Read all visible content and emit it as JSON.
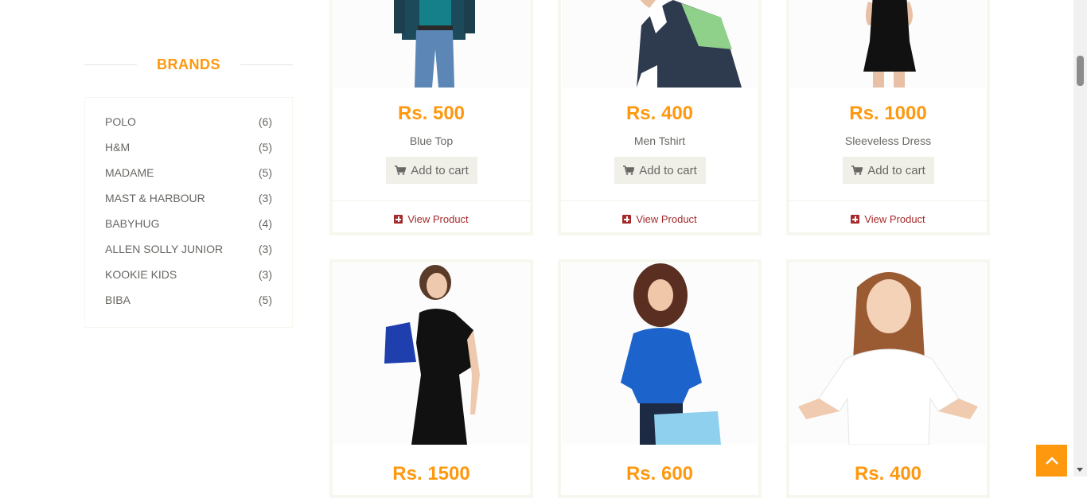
{
  "brands": {
    "title": "BRANDS",
    "items": [
      {
        "name": "POLO",
        "count": "(6)"
      },
      {
        "name": "H&M",
        "count": "(5)"
      },
      {
        "name": "MADAME",
        "count": "(5)"
      },
      {
        "name": "MAST & HARBOUR",
        "count": "(3)"
      },
      {
        "name": "BABYHUG",
        "count": "(4)"
      },
      {
        "name": "ALLEN SOLLY JUNIOR",
        "count": "(3)"
      },
      {
        "name": "KOOKIE KIDS",
        "count": "(3)"
      },
      {
        "name": "BIBA",
        "count": "(5)"
      }
    ]
  },
  "products": [
    {
      "price": "Rs. 500",
      "name": "Blue Top",
      "cart_label": "Add to cart",
      "view_label": "View Product"
    },
    {
      "price": "Rs. 400",
      "name": "Men Tshirt",
      "cart_label": "Add to cart",
      "view_label": "View Product"
    },
    {
      "price": "Rs. 1000",
      "name": "Sleeveless Dress",
      "cart_label": "Add to cart",
      "view_label": "View Product"
    },
    {
      "price": "Rs. 1500"
    },
    {
      "price": "Rs. 600"
    },
    {
      "price": "Rs. 400"
    }
  ],
  "colors": {
    "accent": "#fe980f",
    "view_product": "#a52a2a",
    "button_bg": "#f0f0e9"
  }
}
